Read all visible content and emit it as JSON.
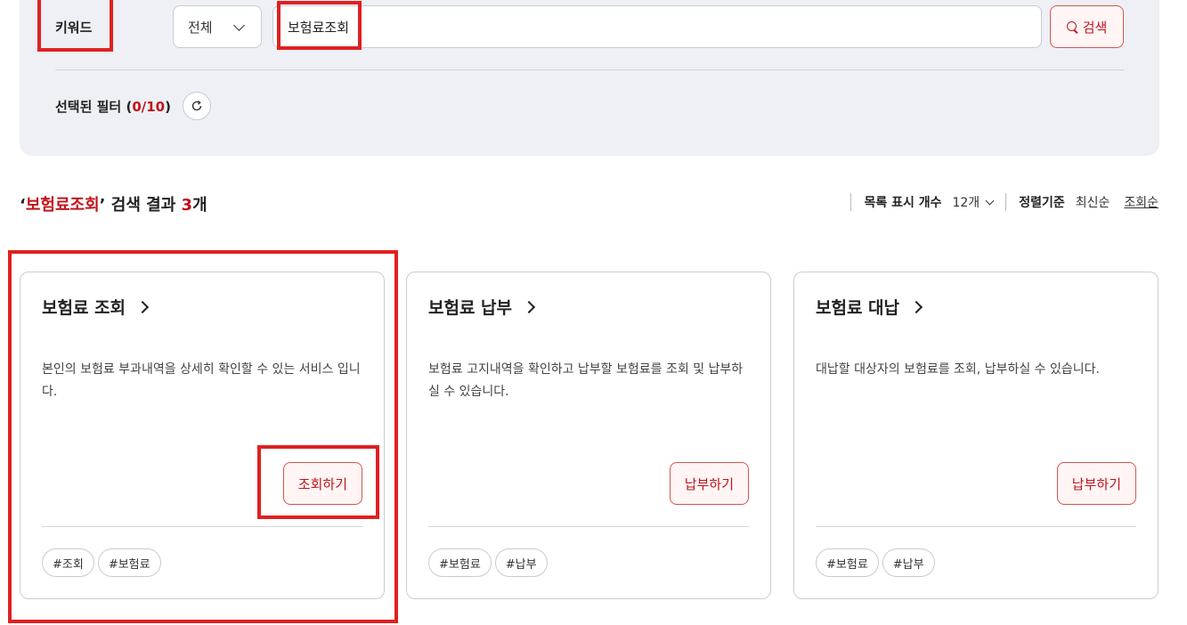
{
  "search": {
    "keyword_label": "키워드",
    "scope_value": "전체",
    "query": "보험료조회",
    "search_button": "검색",
    "filter_label_prefix": "선택된 필터 (",
    "filter_count": "0/10",
    "filter_label_suffix": ")"
  },
  "results": {
    "quote_open": "‘",
    "keyword": "보험료조회",
    "quote_close": "’",
    "text_mid": " 검색 결과 ",
    "count": "3",
    "unit": "개",
    "display_label": "목록 표시 개수",
    "display_value": "12개",
    "sort_label": "정렬기준",
    "sort_options": [
      "최신순",
      "조회순"
    ],
    "active_sort": "조회순"
  },
  "cards": [
    {
      "title": "보험료 조회",
      "description": "본인의 보험료 부과내역을 상세히 확인할 수 있는 서비스 입니다.",
      "button": "조회하기",
      "tags": [
        "#조회",
        "#보험료"
      ]
    },
    {
      "title": "보험료 납부",
      "description": "보험료 고지내역을 확인하고 납부할 보험료를 조회 및 납부하실 수 있습니다.",
      "button": "납부하기",
      "tags": [
        "#보험료",
        "#납부"
      ]
    },
    {
      "title": "보험료 대납",
      "description": "대납할 대상자의 보험료를 조회, 납부하실 수 있습니다.",
      "button": "납부하기",
      "tags": [
        "#보험료",
        "#납부"
      ]
    }
  ],
  "colors": {
    "accent": "#c0141c",
    "panel_bg": "#eef0f5",
    "highlight": "#e02020"
  },
  "icons": [
    "chevron-down-icon",
    "search-icon",
    "refresh-icon",
    "chevron-right-icon"
  ]
}
